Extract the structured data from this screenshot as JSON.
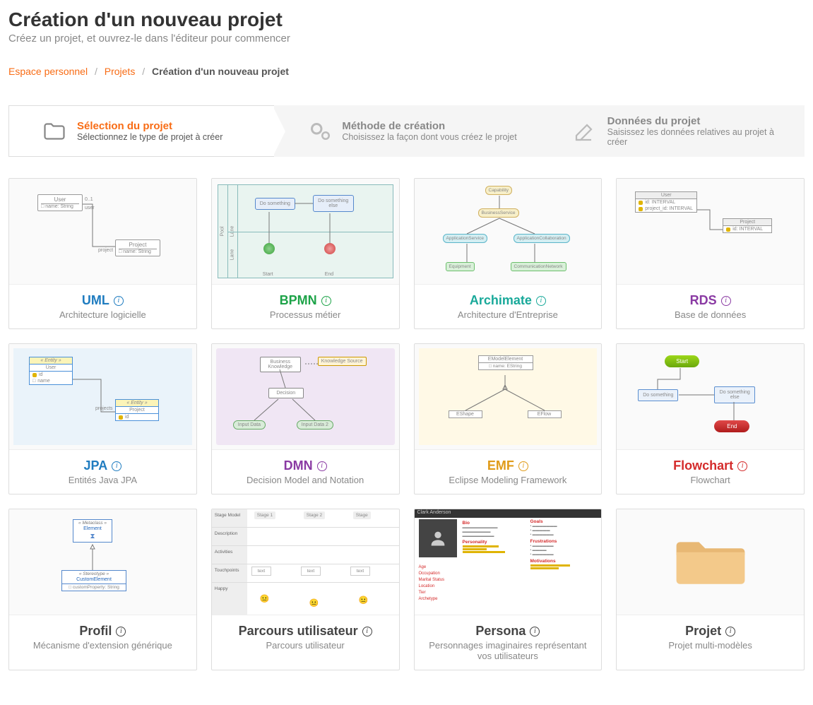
{
  "header": {
    "title": "Création d'un nouveau projet",
    "subtitle": "Créez un projet, et ouvrez-le dans l'éditeur pour commencer"
  },
  "breadcrumb": {
    "home": "Espace personnel",
    "projects": "Projets",
    "current": "Création d'un nouveau projet"
  },
  "wizard": {
    "step1": {
      "title": "Sélection du projet",
      "sub": "Sélectionnez le type de projet à créer"
    },
    "step2": {
      "title": "Méthode de création",
      "sub": "Choisissez la façon dont vous créez le projet"
    },
    "step3": {
      "title": "Données du projet",
      "sub": "Saisissez les données relatives au projet à créer"
    }
  },
  "cards": {
    "uml": {
      "title": "UML",
      "desc": "Architecture logicielle"
    },
    "bpmn": {
      "title": "BPMN",
      "desc": "Processus métier"
    },
    "archimate": {
      "title": "Archimate",
      "desc": "Architecture d'Entreprise"
    },
    "rds": {
      "title": "RDS",
      "desc": "Base de données"
    },
    "jpa": {
      "title": "JPA",
      "desc": "Entités Java JPA"
    },
    "dmn": {
      "title": "DMN",
      "desc": "Decision Model and Notation"
    },
    "emf": {
      "title": "EMF",
      "desc": "Eclipse Modeling Framework"
    },
    "flowchart": {
      "title": "Flowchart",
      "desc": "Flowchart"
    },
    "profil": {
      "title": "Profil",
      "desc": "Mécanisme d'extension générique"
    },
    "parcours": {
      "title": "Parcours utilisateur",
      "desc": "Parcours utilisateur"
    },
    "persona": {
      "title": "Persona",
      "desc": "Personnages imaginaires représentant vos utilisateurs"
    },
    "projet": {
      "title": "Projet",
      "desc": "Projet multi-modèles"
    }
  },
  "preview": {
    "uml": {
      "user": "User",
      "project": "Project",
      "attr": "name: String",
      "mult": "0..1",
      "roleUser": "user",
      "roleProject": "project"
    },
    "bpmn": {
      "pool": "Pool",
      "lane": "Lane",
      "task1": "Do something",
      "task2": "Do something else",
      "start": "Start",
      "end": "End"
    },
    "archimate": {
      "cap": "Capability",
      "bs": "BusinessService",
      "as": "ApplicationService",
      "ac": "ApplicationCollaboration",
      "eq": "Equipment",
      "cn": "CommunicationNetwork"
    },
    "rds": {
      "user": "User",
      "project": "Project",
      "id": "id: INTERVAL",
      "pid": "project_id: INTERVAL"
    },
    "jpa": {
      "entity": "« Entity »",
      "user": "User",
      "project": "Project",
      "id": "id",
      "name": "name",
      "rel": "projects"
    },
    "dmn": {
      "bk": "Business Knowledge",
      "ks": "Knowledge Source",
      "dec": "Decision",
      "in1": "Input Data",
      "in2": "Input Data 2"
    },
    "emf": {
      "top": "EModelElement",
      "attr": "name: EString",
      "left": "EShape",
      "right": "EFlow"
    },
    "flowchart": {
      "start": "Start",
      "t1": "Do something",
      "t2": "Do something else",
      "end": "End"
    },
    "profil": {
      "meta": "« Metaclass »",
      "elem": "Element",
      "stereo": "« Stereotype »",
      "ce": "CustomElement",
      "prop": "customProperty: String"
    },
    "parcours": {
      "sm": "Stage Model",
      "s1": "Stage 1",
      "s2": "Stage 2",
      "s3": "Stage",
      "desc": "Description",
      "act": "Activities",
      "tp": "Touchpoints",
      "txt": "text",
      "hap": "Happy"
    },
    "persona": {
      "name": "Clark Anderson",
      "bio": "Bio",
      "pers": "Personality",
      "age": "Age",
      "occ": "Occupation",
      "ms": "Marital Status",
      "loc": "Location",
      "tier": "Tier",
      "arch": "Archetype",
      "goals": "Goals",
      "frus": "Frustrations",
      "mot": "Motivations"
    }
  }
}
